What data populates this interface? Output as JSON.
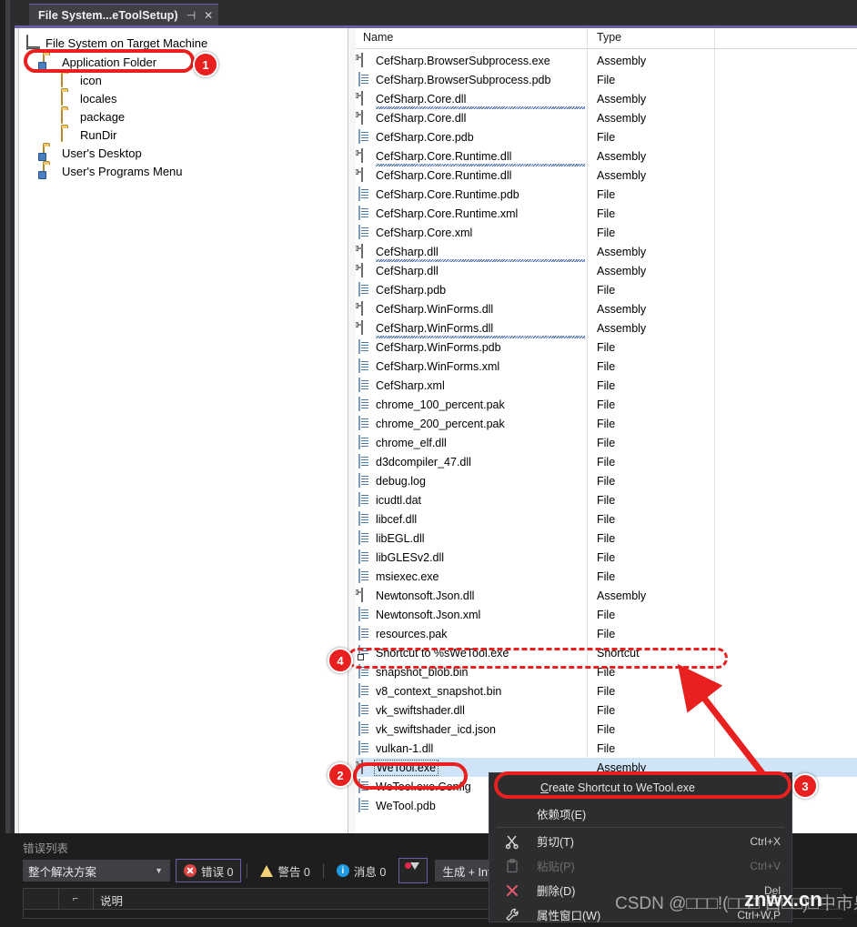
{
  "window": {
    "tab_title": "File System...eToolSetup)",
    "pin_icon": "pin-icon",
    "close_icon": "close-icon",
    "accent_color": "#6a5fa8"
  },
  "tree": {
    "root_label": "File System on Target Machine",
    "items": [
      {
        "label": "Application Folder",
        "icon": "folder-open-icon",
        "depth": 1,
        "selected": true
      },
      {
        "label": "icon",
        "icon": "folder-icon",
        "depth": 2,
        "selected": false
      },
      {
        "label": "locales",
        "icon": "folder-icon",
        "depth": 2,
        "selected": false
      },
      {
        "label": "package",
        "icon": "folder-icon",
        "depth": 2,
        "selected": false
      },
      {
        "label": "RunDir",
        "icon": "folder-icon",
        "depth": 2,
        "selected": false
      },
      {
        "label": "User's Desktop",
        "icon": "folder-open-icon",
        "depth": 1,
        "selected": false
      },
      {
        "label": "User's Programs Menu",
        "icon": "folder-open-icon",
        "depth": 1,
        "selected": false
      }
    ]
  },
  "filelist": {
    "columns": [
      "Name",
      "Type"
    ],
    "rows": [
      {
        "name": "CefSharp.BrowserSubprocess.exe",
        "type": "Assembly",
        "icon": "assembly-icon",
        "squiggle": false,
        "selected": false
      },
      {
        "name": "CefSharp.BrowserSubprocess.pdb",
        "type": "File",
        "icon": "file-icon",
        "squiggle": false,
        "selected": false
      },
      {
        "name": "CefSharp.Core.dll",
        "type": "Assembly",
        "icon": "assembly-icon",
        "squiggle": true,
        "selected": false
      },
      {
        "name": "CefSharp.Core.dll",
        "type": "Assembly",
        "icon": "assembly-icon",
        "squiggle": false,
        "selected": false
      },
      {
        "name": "CefSharp.Core.pdb",
        "type": "File",
        "icon": "file-icon",
        "squiggle": false,
        "selected": false
      },
      {
        "name": "CefSharp.Core.Runtime.dll",
        "type": "Assembly",
        "icon": "assembly-icon",
        "squiggle": true,
        "selected": false
      },
      {
        "name": "CefSharp.Core.Runtime.dll",
        "type": "Assembly",
        "icon": "assembly-icon",
        "squiggle": false,
        "selected": false
      },
      {
        "name": "CefSharp.Core.Runtime.pdb",
        "type": "File",
        "icon": "file-icon",
        "squiggle": false,
        "selected": false
      },
      {
        "name": "CefSharp.Core.Runtime.xml",
        "type": "File",
        "icon": "file-icon",
        "squiggle": false,
        "selected": false
      },
      {
        "name": "CefSharp.Core.xml",
        "type": "File",
        "icon": "file-icon",
        "squiggle": false,
        "selected": false
      },
      {
        "name": "CefSharp.dll",
        "type": "Assembly",
        "icon": "assembly-icon",
        "squiggle": true,
        "selected": false
      },
      {
        "name": "CefSharp.dll",
        "type": "Assembly",
        "icon": "assembly-icon",
        "squiggle": false,
        "selected": false
      },
      {
        "name": "CefSharp.pdb",
        "type": "File",
        "icon": "file-icon",
        "squiggle": false,
        "selected": false
      },
      {
        "name": "CefSharp.WinForms.dll",
        "type": "Assembly",
        "icon": "assembly-icon",
        "squiggle": false,
        "selected": false
      },
      {
        "name": "CefSharp.WinForms.dll",
        "type": "Assembly",
        "icon": "assembly-icon",
        "squiggle": true,
        "selected": false
      },
      {
        "name": "CefSharp.WinForms.pdb",
        "type": "File",
        "icon": "file-icon",
        "squiggle": false,
        "selected": false
      },
      {
        "name": "CefSharp.WinForms.xml",
        "type": "File",
        "icon": "file-icon",
        "squiggle": false,
        "selected": false
      },
      {
        "name": "CefSharp.xml",
        "type": "File",
        "icon": "file-icon",
        "squiggle": false,
        "selected": false
      },
      {
        "name": "chrome_100_percent.pak",
        "type": "File",
        "icon": "file-icon",
        "squiggle": false,
        "selected": false
      },
      {
        "name": "chrome_200_percent.pak",
        "type": "File",
        "icon": "file-icon",
        "squiggle": false,
        "selected": false
      },
      {
        "name": "chrome_elf.dll",
        "type": "File",
        "icon": "file-icon",
        "squiggle": false,
        "selected": false
      },
      {
        "name": "d3dcompiler_47.dll",
        "type": "File",
        "icon": "file-icon",
        "squiggle": false,
        "selected": false
      },
      {
        "name": "debug.log",
        "type": "File",
        "icon": "file-icon",
        "squiggle": false,
        "selected": false
      },
      {
        "name": "icudtl.dat",
        "type": "File",
        "icon": "file-icon",
        "squiggle": false,
        "selected": false
      },
      {
        "name": "libcef.dll",
        "type": "File",
        "icon": "file-icon",
        "squiggle": false,
        "selected": false
      },
      {
        "name": "libEGL.dll",
        "type": "File",
        "icon": "file-icon",
        "squiggle": false,
        "selected": false
      },
      {
        "name": "libGLESv2.dll",
        "type": "File",
        "icon": "file-icon",
        "squiggle": false,
        "selected": false
      },
      {
        "name": "msiexec.exe",
        "type": "File",
        "icon": "file-icon",
        "squiggle": false,
        "selected": false
      },
      {
        "name": "Newtonsoft.Json.dll",
        "type": "Assembly",
        "icon": "assembly-icon",
        "squiggle": false,
        "selected": false
      },
      {
        "name": "Newtonsoft.Json.xml",
        "type": "File",
        "icon": "file-icon",
        "squiggle": false,
        "selected": false
      },
      {
        "name": "resources.pak",
        "type": "File",
        "icon": "file-icon",
        "squiggle": false,
        "selected": false
      },
      {
        "name": "Shortcut to %sWeTool.exe",
        "type": "Shortcut",
        "icon": "shortcut-icon",
        "squiggle": false,
        "selected": false
      },
      {
        "name": "snapshot_blob.bin",
        "type": "File",
        "icon": "file-icon",
        "squiggle": false,
        "selected": false
      },
      {
        "name": "v8_context_snapshot.bin",
        "type": "File",
        "icon": "file-icon",
        "squiggle": false,
        "selected": false
      },
      {
        "name": "vk_swiftshader.dll",
        "type": "File",
        "icon": "file-icon",
        "squiggle": false,
        "selected": false
      },
      {
        "name": "vk_swiftshader_icd.json",
        "type": "File",
        "icon": "file-icon",
        "squiggle": false,
        "selected": false
      },
      {
        "name": "vulkan-1.dll",
        "type": "File",
        "icon": "file-icon",
        "squiggle": false,
        "selected": false
      },
      {
        "name": "WeTool.exe",
        "type": "Assembly",
        "icon": "assembly-icon",
        "squiggle": false,
        "selected": true
      },
      {
        "name": "WeTool.exe.Config",
        "type": "File",
        "icon": "file-icon",
        "squiggle": false,
        "selected": false
      },
      {
        "name": "WeTool.pdb",
        "type": "File",
        "icon": "file-icon",
        "squiggle": false,
        "selected": false
      }
    ]
  },
  "context_menu": {
    "items": [
      {
        "label": "Create Shortcut to WeTool.exe",
        "accel": "C",
        "shortcut": "",
        "icon": "",
        "disabled": false
      },
      {
        "label": "依赖项(E)",
        "accel": "",
        "shortcut": "",
        "icon": "",
        "disabled": false
      },
      {
        "label": "剪切(T)",
        "accel": "",
        "shortcut": "Ctrl+X",
        "icon": "scissors-icon",
        "disabled": false
      },
      {
        "label": "粘贴(P)",
        "accel": "",
        "shortcut": "Ctrl+V",
        "icon": "clipboard-icon",
        "disabled": true
      },
      {
        "label": "删除(D)",
        "accel": "",
        "shortcut": "Del",
        "icon": "delete-x-icon",
        "disabled": false
      },
      {
        "label": "属性窗口(W)",
        "accel": "",
        "shortcut": "Ctrl+W,P",
        "icon": "wrench-icon",
        "disabled": false
      }
    ]
  },
  "error_list": {
    "title": "错误列表",
    "scope": "整个解决方案",
    "errors_label": "错误 0",
    "warnings_label": "警告 0",
    "messages_label": "消息 0",
    "filter_icon": "filter-icon",
    "build_filter": "生成 + IntelliSense",
    "column_description": "说明",
    "column_code_icon": "sort-indicator-icon"
  },
  "annotations": {
    "badges": [
      {
        "n": "1"
      },
      {
        "n": "2"
      },
      {
        "n": "3"
      },
      {
        "n": "4"
      }
    ]
  },
  "watermarks": {
    "csdn": "CSDN @□□□!(□□□ 白□□)□中市泉躁",
    "site": "znwx.cn"
  }
}
